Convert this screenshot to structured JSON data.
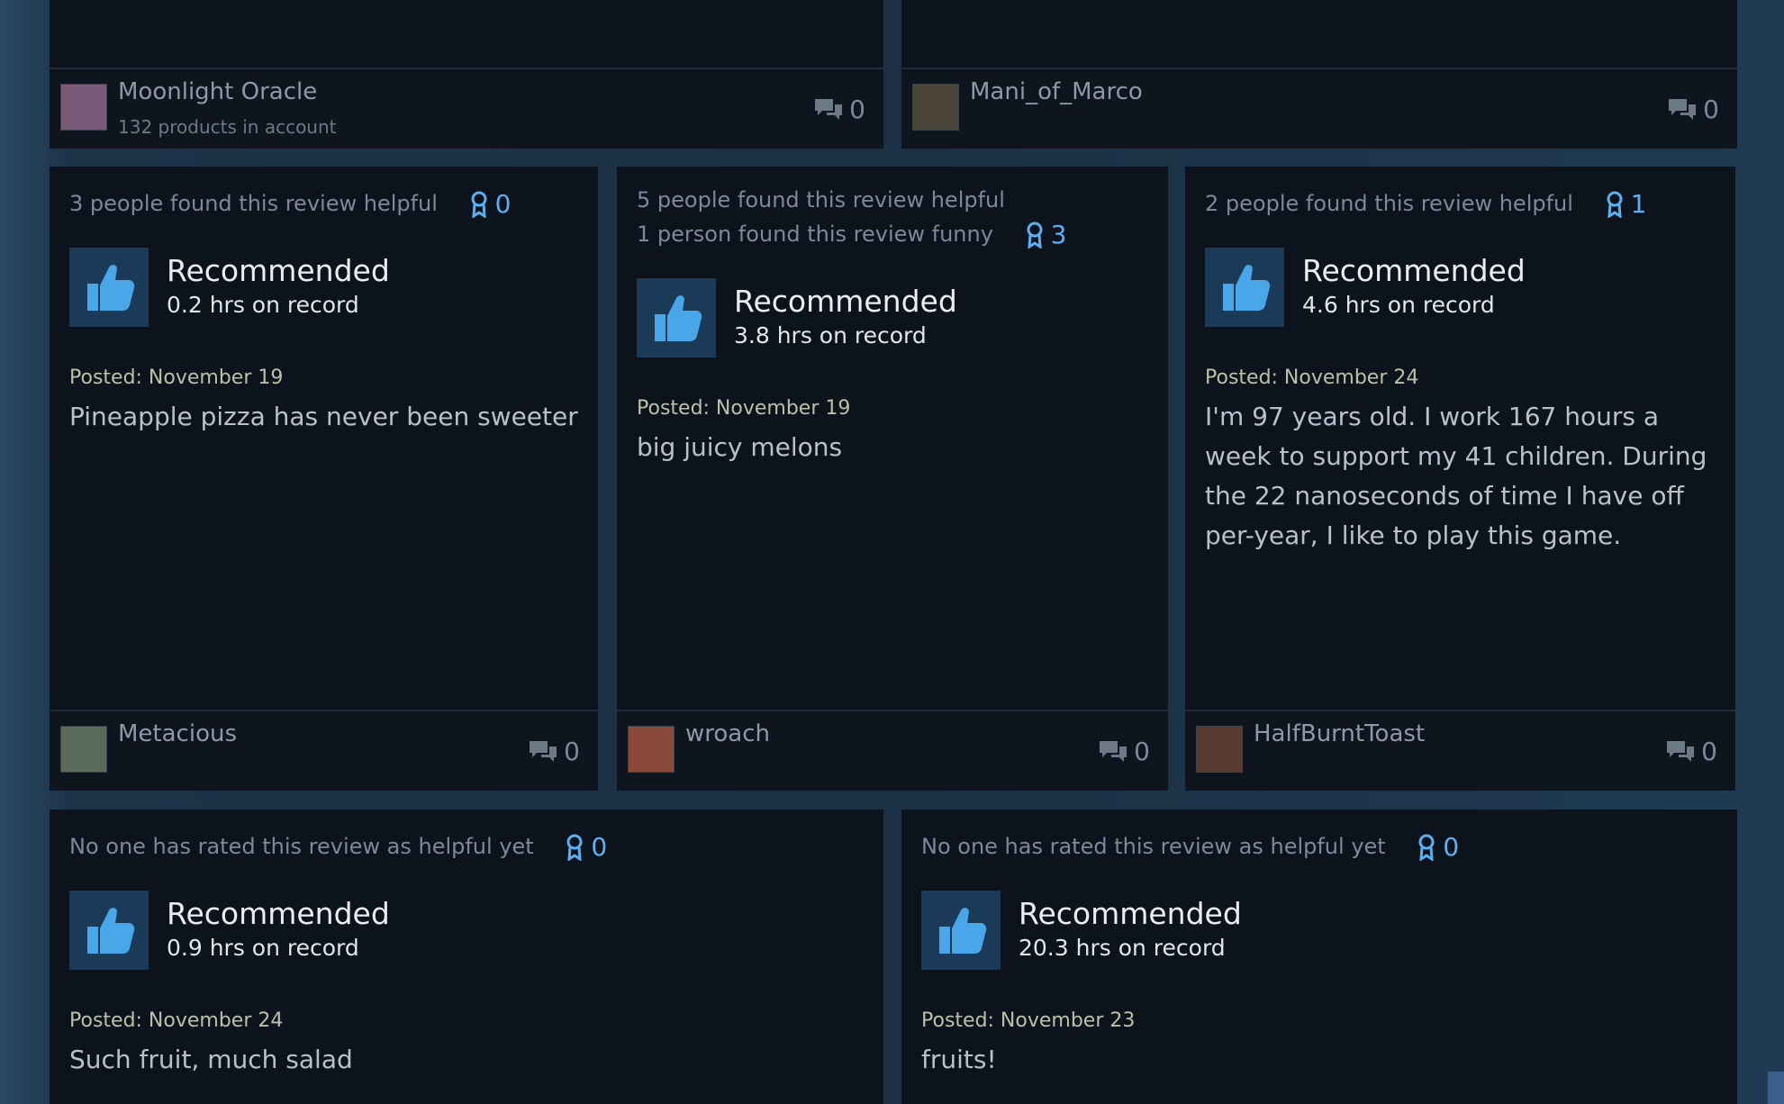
{
  "top_cards": [
    {
      "author": "Moonlight Oracle",
      "products": "132 products in account",
      "comments": "0",
      "avatar_color": "#7a5a78"
    },
    {
      "author": "Mani_of_Marco",
      "products": "",
      "comments": "0",
      "avatar_color": "#4a4438"
    }
  ],
  "middle_cards": [
    {
      "helpful_lines": [
        "3 people found this review helpful"
      ],
      "awards": "0",
      "recommended": "Recommended",
      "hours": "0.2 hrs on record",
      "posted": "Posted: November 19",
      "text": "Pineapple pizza has never been sweeter",
      "author": "Metacious",
      "comments": "0",
      "avatar_color": "#5a6a5a"
    },
    {
      "helpful_lines": [
        "5 people found this review helpful",
        "1 person found this review funny"
      ],
      "awards": "3",
      "recommended": "Recommended",
      "hours": "3.8 hrs on record",
      "posted": "Posted: November 19",
      "text": "big juicy melons",
      "author": "wroach",
      "comments": "0",
      "avatar_color": "#8a4a3a"
    },
    {
      "helpful_lines": [
        "2 people found this review helpful"
      ],
      "awards": "1",
      "recommended": "Recommended",
      "hours": "4.6 hrs on record",
      "posted": "Posted: November 24",
      "text": "I'm 97 years old. I work 167 hours a week to support my 41 children. During the 22 nanoseconds of time I have off per-year, I like to play this game.",
      "author": "HalfBurntToast",
      "comments": "0",
      "avatar_color": "#5a3a30"
    }
  ],
  "bottom_cards": [
    {
      "helpful_lines": [
        "No one has rated this review as helpful yet"
      ],
      "awards": "0",
      "recommended": "Recommended",
      "hours": "0.9 hrs on record",
      "posted": "Posted: November 24",
      "text": "Such fruit, much salad"
    },
    {
      "helpful_lines": [
        "No one has rated this review as helpful yet"
      ],
      "awards": "0",
      "recommended": "Recommended",
      "hours": "20.3 hrs on record",
      "posted": "Posted: November 23",
      "text": "fruits!"
    }
  ],
  "colors": {
    "accent": "#5ab1f2",
    "card_bg": "#0d131d",
    "thumb_bg": "#1b3a58"
  }
}
